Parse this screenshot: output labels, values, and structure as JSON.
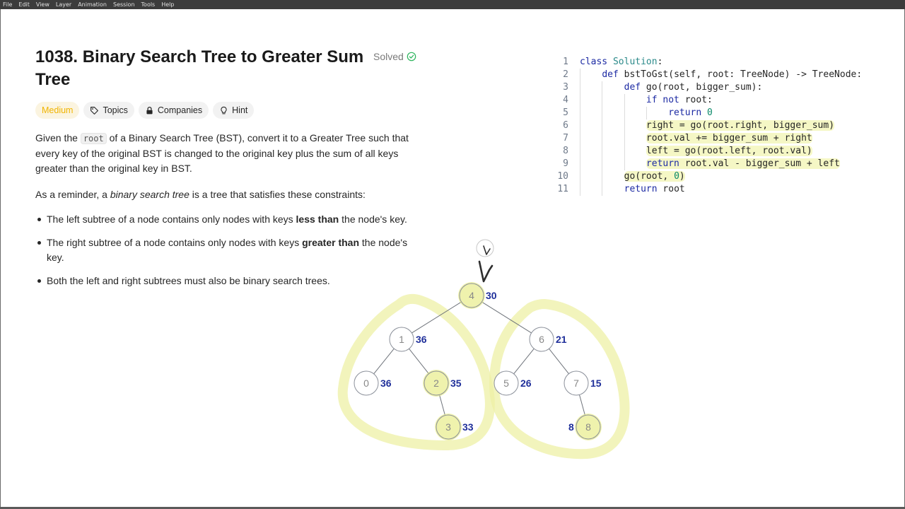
{
  "menu": [
    "File",
    "Edit",
    "View",
    "Layer",
    "Animation",
    "Session",
    "Tools",
    "Help"
  ],
  "problem": {
    "title": "1038. Binary Search Tree to Greater Sum Tree",
    "status": "Solved",
    "status_icon": "check-circle-icon",
    "tags": [
      {
        "label": "Medium",
        "icon": ""
      },
      {
        "label": "Topics",
        "icon": "tag-icon"
      },
      {
        "label": "Companies",
        "icon": "lock-icon"
      },
      {
        "label": "Hint",
        "icon": "lightbulb-icon"
      }
    ],
    "para1_a": "Given the ",
    "para1_code": "root",
    "para1_b": " of a Binary Search Tree (BST), convert it to a Greater Tree such that every key of the original BST is changed to the original key plus the sum of all keys greater than the original key in BST.",
    "para2_a": "As a reminder, a ",
    "para2_em": "binary search tree",
    "para2_b": " is a tree that satisfies these constraints:",
    "bullets": [
      {
        "a": "The left subtree of a node contains only nodes with keys ",
        "b": "less than",
        "c": " the node's key."
      },
      {
        "a": "The right subtree of a node contains only nodes with keys ",
        "b": "greater than",
        "c": " the node's key."
      },
      {
        "a": "Both the left and right subtrees must also be binary search trees.",
        "b": "",
        "c": ""
      }
    ]
  },
  "code": {
    "line_numbers": [
      "1",
      "2",
      "3",
      "4",
      "5",
      "6",
      "7",
      "8",
      "9",
      "10",
      "11"
    ],
    "lines": [
      "class Solution:",
      "    def bstToGst(self, root: TreeNode) -> TreeNode:",
      "        def go(root, bigger_sum):",
      "            if not root:",
      "                return 0",
      "            right = go(root.right, bigger_sum)",
      "            root.val += bigger_sum + right",
      "            left = go(root.left, root.val)",
      "            return root.val - bigger_sum + left",
      "        go(root, 0)",
      "        return root"
    ]
  },
  "tree": {
    "nodes": [
      {
        "id": "n4",
        "key": "4",
        "sum": "30",
        "highlight": true
      },
      {
        "id": "n1",
        "key": "1",
        "sum": "36",
        "highlight": false
      },
      {
        "id": "n6",
        "key": "6",
        "sum": "21",
        "highlight": false
      },
      {
        "id": "n0",
        "key": "0",
        "sum": "36",
        "highlight": false
      },
      {
        "id": "n2",
        "key": "2",
        "sum": "35",
        "highlight": true
      },
      {
        "id": "n5",
        "key": "5",
        "sum": "26",
        "highlight": false
      },
      {
        "id": "n7",
        "key": "7",
        "sum": "15",
        "highlight": false
      },
      {
        "id": "n3",
        "key": "3",
        "sum": "33",
        "highlight": true
      },
      {
        "id": "n8",
        "key": "8",
        "sum": "8",
        "highlight": true
      }
    ],
    "edges": [
      [
        "n4",
        "n1"
      ],
      [
        "n4",
        "n6"
      ],
      [
        "n1",
        "n0"
      ],
      [
        "n1",
        "n2"
      ],
      [
        "n6",
        "n5"
      ],
      [
        "n6",
        "n7"
      ],
      [
        "n2",
        "n3"
      ],
      [
        "n7",
        "n8"
      ]
    ],
    "annotation_color": "#e8ec8a",
    "node_stroke": "#8a8f99"
  }
}
